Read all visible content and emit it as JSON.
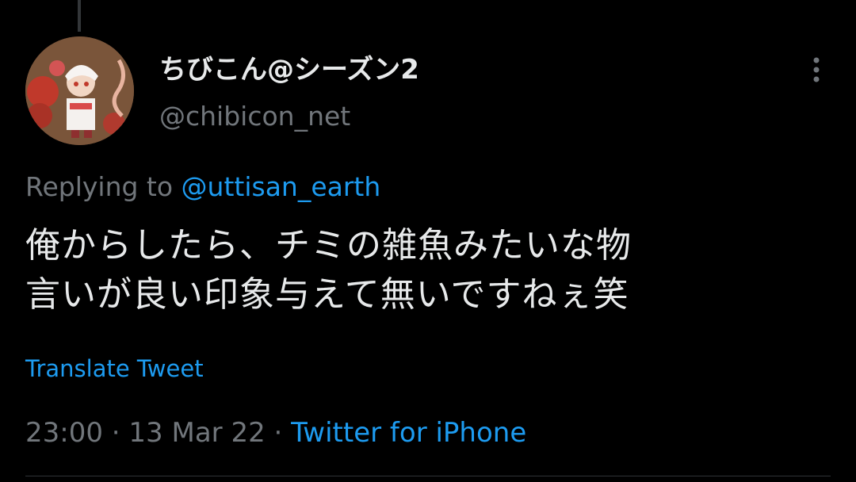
{
  "tweet": {
    "author": {
      "display_name": "ちびこん@シーズン2",
      "handle": "@chibicon_net"
    },
    "replying_prefix": "Replying to",
    "replying_to": "@uttisan_earth",
    "text_line1": "俺からしたら、チミの雑魚みたいな物",
    "text_line2": "言いが良い印象与えて無いですねぇ笑",
    "translate_label": "Translate Tweet",
    "time": "23:00",
    "separator": "·",
    "date": "13 Mar 22",
    "source": "Twitter for iPhone"
  },
  "icons": {
    "more": "more-vertical-icon"
  },
  "colors": {
    "background": "#000000",
    "primary_text": "#e7e9ea",
    "secondary_text": "#71767b",
    "accent": "#1d9bf0"
  }
}
